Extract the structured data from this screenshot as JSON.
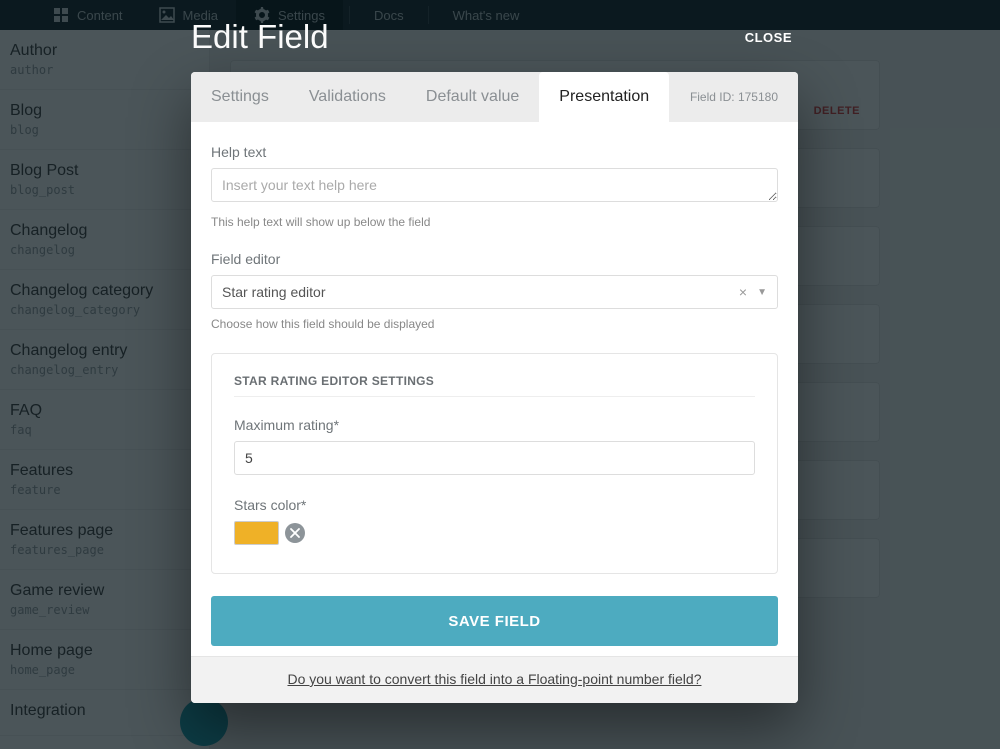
{
  "topnav": {
    "items": [
      {
        "label": "Content"
      },
      {
        "label": "Media"
      },
      {
        "label": "Settings"
      },
      {
        "label": "Docs"
      },
      {
        "label": "What's new"
      }
    ]
  },
  "sidebar": {
    "items": [
      {
        "label": "Author",
        "api": "author"
      },
      {
        "label": "Blog",
        "api": "blog"
      },
      {
        "label": "Blog Post",
        "api": "blog_post"
      },
      {
        "label": "Changelog",
        "api": "changelog"
      },
      {
        "label": "Changelog category",
        "api": "changelog_category"
      },
      {
        "label": "Changelog entry",
        "api": "changelog_entry"
      },
      {
        "label": "FAQ",
        "api": "faq"
      },
      {
        "label": "Features",
        "api": "feature"
      },
      {
        "label": "Features page",
        "api": "features_page"
      },
      {
        "label": "Game review",
        "api": "game_review"
      },
      {
        "label": "Home page",
        "api": "home_page"
      },
      {
        "label": "Integration",
        "api": ""
      }
    ]
  },
  "delete_label": "DELETE",
  "modal": {
    "title": "Edit Field",
    "close": "CLOSE",
    "tabs": [
      {
        "label": "Settings"
      },
      {
        "label": "Validations"
      },
      {
        "label": "Default value"
      },
      {
        "label": "Presentation"
      }
    ],
    "field_id": "Field ID: 175180",
    "help_text_label": "Help text",
    "help_text_placeholder": "Insert your text help here",
    "help_text_hint": "This help text will show up below the field",
    "field_editor_label": "Field editor",
    "field_editor_value": "Star rating editor",
    "field_editor_hint": "Choose how this field should be displayed",
    "editor_settings": {
      "heading": "STAR RATING EDITOR SETTINGS",
      "max_label": "Maximum rating*",
      "max_value": "5",
      "color_label": "Stars color*",
      "color_value": "#efb127"
    },
    "save_label": "SAVE FIELD",
    "convert_link": "Do you want to convert this field into a Floating-point number field?"
  }
}
